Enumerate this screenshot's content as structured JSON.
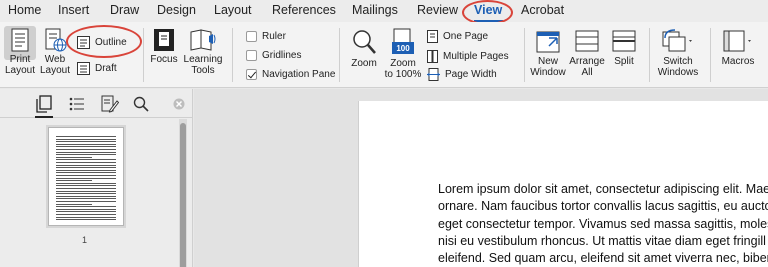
{
  "tabs": [
    {
      "label": "Home"
    },
    {
      "label": "Insert"
    },
    {
      "label": "Draw"
    },
    {
      "label": "Design"
    },
    {
      "label": "Layout"
    },
    {
      "label": "References"
    },
    {
      "label": "Mailings"
    },
    {
      "label": "Review"
    },
    {
      "label": "View"
    },
    {
      "label": "Acrobat"
    }
  ],
  "ribbon": {
    "print_layout": "Print\nLayout",
    "web_layout": "Web\nLayout",
    "outline": "Outline",
    "draft": "Draft",
    "focus": "Focus",
    "learning_tools": "Learning\nTools",
    "ruler": "Ruler",
    "gridlines": "Gridlines",
    "navigation_pane": "Navigation Pane",
    "ruler_checked": false,
    "gridlines_checked": false,
    "navigation_pane_checked": true,
    "zoom": "Zoom",
    "zoom_100": "Zoom\nto 100%",
    "zoom_100_badge": "100",
    "one_page": "One Page",
    "multiple_pages": "Multiple Pages",
    "page_width": "Page Width",
    "new_window": "New\nWindow",
    "arrange_all": "Arrange\nAll",
    "split": "Split",
    "switch_windows": "Switch\nWindows",
    "macros": "Macros"
  },
  "nav_pane": {
    "page_number": "1"
  },
  "document": {
    "lines": [
      "Lorem ipsum dolor sit amet, consectetur adipiscing elit. Mae",
      "ornare. Nam faucibus tortor convallis lacus sagittis, eu auctor",
      "eget consectetur tempor. Vivamus sed massa sagittis, molesti",
      "nisi eu vestibulum rhoncus. Ut mattis vitae diam eget fringill",
      "eleifend. Sed quam arcu, eleifend sit amet viverra nec, biben"
    ]
  },
  "colors": {
    "accent": "#1d5fb4",
    "annotation": "#d9443a"
  }
}
